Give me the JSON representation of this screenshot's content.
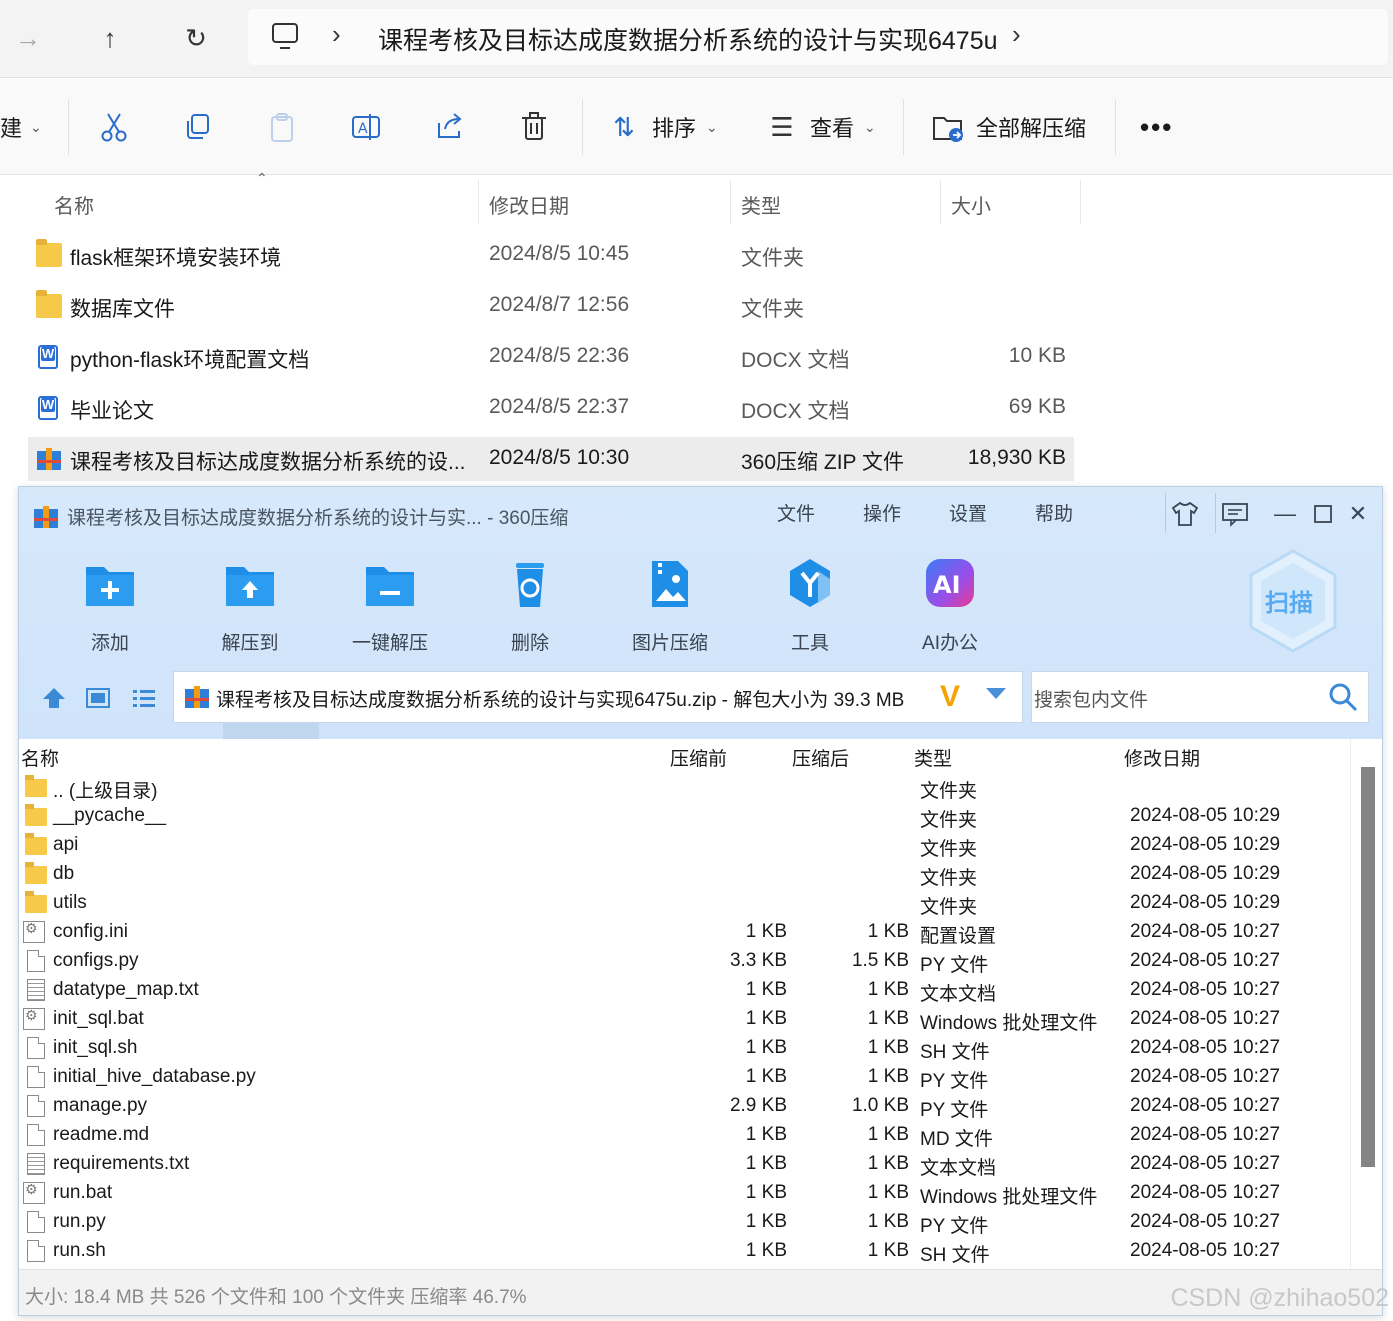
{
  "explorer": {
    "nav": {
      "path_label": "课程考核及目标达成度数据分析系统的设计与实现6475u"
    },
    "toolbar": {
      "new_label": "建",
      "sort_label": "排序",
      "view_label": "查看",
      "extract_all_label": "全部解压缩"
    },
    "columns": {
      "name": "名称",
      "date": "修改日期",
      "type": "类型",
      "size": "大小"
    },
    "files": [
      {
        "icon": "folder-icon",
        "name": "flask框架环境安装环境",
        "date": "2024/8/5 10:45",
        "type": "文件夹",
        "size": ""
      },
      {
        "icon": "folder-icon",
        "name": "数据库文件",
        "date": "2024/8/7 12:56",
        "type": "文件夹",
        "size": ""
      },
      {
        "icon": "word-doc-icon",
        "name": "python-flask环境配置文档",
        "date": "2024/8/5 22:36",
        "type": "DOCX 文档",
        "size": "10 KB"
      },
      {
        "icon": "word-doc-icon",
        "name": "毕业论文",
        "date": "2024/8/5 22:37",
        "type": "DOCX 文档",
        "size": "69 KB"
      },
      {
        "icon": "zip-archive-icon",
        "name": "课程考核及目标达成度数据分析系统的设...",
        "date": "2024/8/5 10:30",
        "type": "360压缩 ZIP 文件",
        "size": "18,930 KB"
      }
    ]
  },
  "archiver": {
    "title": "课程考核及目标达成度数据分析系统的设计与实... - 360压缩",
    "menu": [
      "文件",
      "操作",
      "设置",
      "帮助"
    ],
    "actions": [
      {
        "icon": "add-icon",
        "label": "添加"
      },
      {
        "icon": "extract-to-icon",
        "label": "解压到"
      },
      {
        "icon": "one-click-extract-icon",
        "label": "一键解压"
      },
      {
        "icon": "delete-icon",
        "label": "删除"
      },
      {
        "icon": "image-compress-icon",
        "label": "图片压缩"
      },
      {
        "icon": "tools-icon",
        "label": "工具"
      },
      {
        "icon": "ai-office-icon",
        "label": "AI办公"
      }
    ],
    "scan_label": "扫描",
    "address": "课程考核及目标达成度数据分析系统的设计与实现6475u.zip - 解包大小为 39.3 MB",
    "address_v": "V",
    "search_placeholder": "搜索包内文件",
    "columns": {
      "name": "名称",
      "before": "压缩前",
      "after": "压缩后",
      "type": "类型",
      "date": "修改日期"
    },
    "entries": [
      {
        "icon": "folder",
        "name": ".. (上级目录)",
        "before": "",
        "after": "",
        "type": "文件夹",
        "date": ""
      },
      {
        "icon": "folder",
        "name": "__pycache__",
        "before": "",
        "after": "",
        "type": "文件夹",
        "date": "2024-08-05 10:29"
      },
      {
        "icon": "folder",
        "name": "api",
        "before": "",
        "after": "",
        "type": "文件夹",
        "date": "2024-08-05 10:29"
      },
      {
        "icon": "folder",
        "name": "db",
        "before": "",
        "after": "",
        "type": "文件夹",
        "date": "2024-08-05 10:29"
      },
      {
        "icon": "folder",
        "name": "utils",
        "before": "",
        "after": "",
        "type": "文件夹",
        "date": "2024-08-05 10:29"
      },
      {
        "icon": "gear",
        "name": "config.ini",
        "before": "1 KB",
        "after": "1 KB",
        "type": "配置设置",
        "date": "2024-08-05 10:27"
      },
      {
        "icon": "file",
        "name": "configs.py",
        "before": "3.3 KB",
        "after": "1.5 KB",
        "type": "PY 文件",
        "date": "2024-08-05 10:27"
      },
      {
        "icon": "text",
        "name": "datatype_map.txt",
        "before": "1 KB",
        "after": "1 KB",
        "type": "文本文档",
        "date": "2024-08-05 10:27"
      },
      {
        "icon": "gear",
        "name": "init_sql.bat",
        "before": "1 KB",
        "after": "1 KB",
        "type": "Windows 批处理文件",
        "date": "2024-08-05 10:27"
      },
      {
        "icon": "file",
        "name": "init_sql.sh",
        "before": "1 KB",
        "after": "1 KB",
        "type": "SH 文件",
        "date": "2024-08-05 10:27"
      },
      {
        "icon": "file",
        "name": "initial_hive_database.py",
        "before": "1 KB",
        "after": "1 KB",
        "type": "PY 文件",
        "date": "2024-08-05 10:27"
      },
      {
        "icon": "file",
        "name": "manage.py",
        "before": "2.9 KB",
        "after": "1.0 KB",
        "type": "PY 文件",
        "date": "2024-08-05 10:27"
      },
      {
        "icon": "file",
        "name": "readme.md",
        "before": "1 KB",
        "after": "1 KB",
        "type": "MD 文件",
        "date": "2024-08-05 10:27"
      },
      {
        "icon": "text",
        "name": "requirements.txt",
        "before": "1 KB",
        "after": "1 KB",
        "type": "文本文档",
        "date": "2024-08-05 10:27"
      },
      {
        "icon": "gear",
        "name": "run.bat",
        "before": "1 KB",
        "after": "1 KB",
        "type": "Windows 批处理文件",
        "date": "2024-08-05 10:27"
      },
      {
        "icon": "file",
        "name": "run.py",
        "before": "1 KB",
        "after": "1 KB",
        "type": "PY 文件",
        "date": "2024-08-05 10:27"
      },
      {
        "icon": "file",
        "name": "run.sh",
        "before": "1 KB",
        "after": "1 KB",
        "type": "SH 文件",
        "date": "2024-08-05 10:27"
      }
    ],
    "status": "大小: 18.4 MB 共 526 个文件和 100 个文件夹 压缩率 46.7%"
  },
  "watermark": "CSDN @zhihao502",
  "colors": {
    "accent_blue": "#2b8be6",
    "folder_yellow": "#f7c948",
    "archiver_header": "#d7e8fb"
  }
}
